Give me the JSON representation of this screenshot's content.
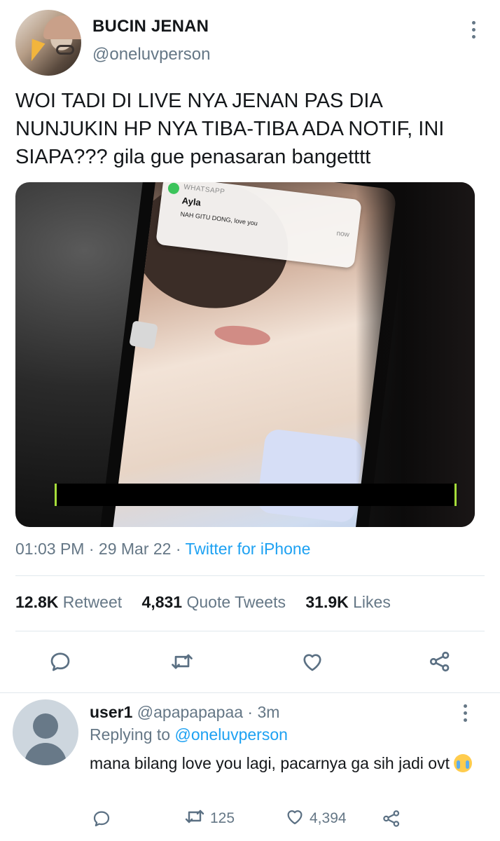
{
  "tweet": {
    "display_name": "BUCIN JENAN",
    "handle": "@oneluvperson",
    "text": "WOI TADI DI LIVE NYA JENAN PAS DIA\nNUNJUKIN HP NYA TIBA-TIBA ADA NOTIF, INI\nSIAPA??? gila gue penasaran bangetttt",
    "media": {
      "notification": {
        "app": "WHATSAPP",
        "sender": "Ayla",
        "message": "NAH GITU DONG, love you",
        "time": "now"
      }
    },
    "time": "01:03 PM",
    "date": "29 Mar 22",
    "source": "Twitter for iPhone",
    "stats": {
      "retweets": "12.8K",
      "retweets_label": "Retweet",
      "quotes": "4,831",
      "quotes_label": "Quote Tweets",
      "likes": "31.9K",
      "likes_label": "Likes"
    }
  },
  "reply": {
    "name": "user1",
    "handle": "@apapapapaa",
    "age": "3m",
    "replying_label": "Replying to",
    "replying_to": "@oneluvperson",
    "text": "mana bilang love you lagi, pacarnya ga sih jadi ovt",
    "retweets": "125",
    "likes": "4,394"
  },
  "colors": {
    "accent": "#1da1f2",
    "secondary_text": "#657786",
    "icon": "#5b7083"
  },
  "icons": [
    "more-vertical-icon",
    "reply-icon",
    "retweet-icon",
    "like-icon",
    "share-icon",
    "whatsapp-icon"
  ]
}
